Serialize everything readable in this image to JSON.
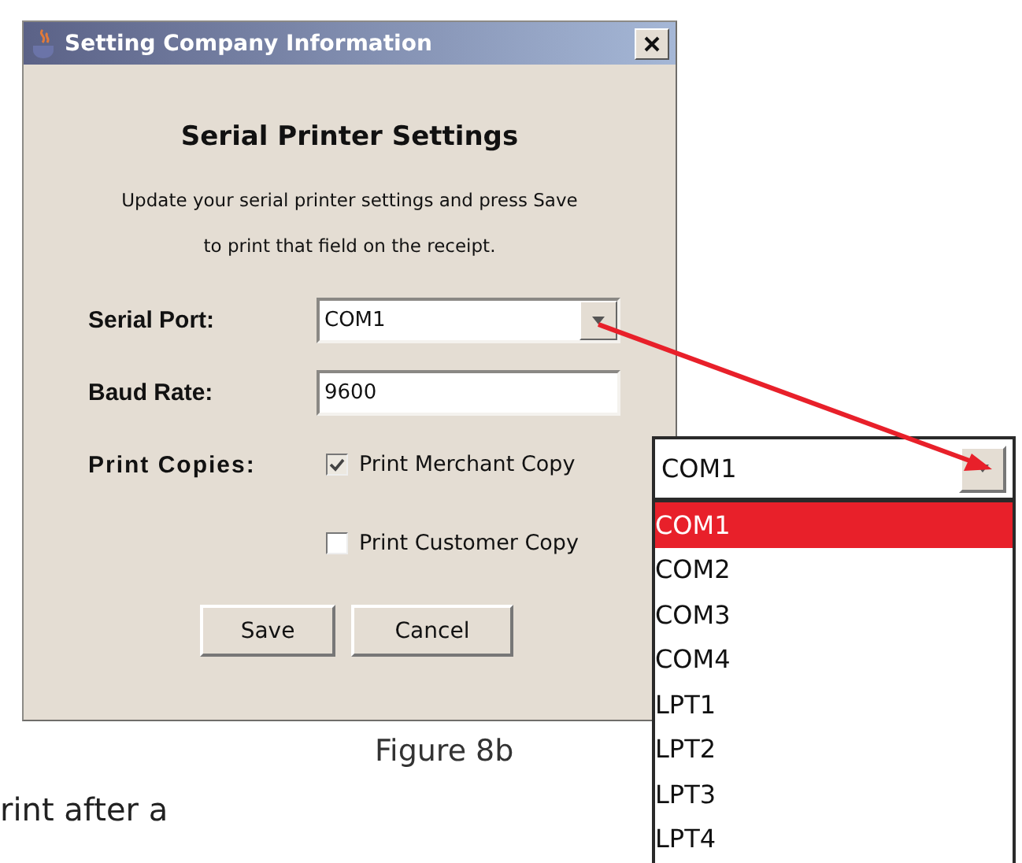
{
  "window": {
    "title": "Setting Company Information"
  },
  "heading": "Serial Printer Settings",
  "description": [
    "Update your serial printer settings and press Save",
    "to print that field on the receipt."
  ],
  "serial_port": {
    "label": "Serial Port:",
    "value": "COM1"
  },
  "baud_rate": {
    "label": "Baud Rate:",
    "value": "9600"
  },
  "print_copies": {
    "label": "Print Copies:",
    "options": [
      {
        "label": "Print Merchant Copy",
        "checked": true
      },
      {
        "label": "Print Customer Copy",
        "checked": false
      }
    ]
  },
  "buttons": [
    "Save",
    "Cancel"
  ],
  "dropdown_inset": {
    "value": "COM1",
    "options": [
      {
        "label": "COM1",
        "selected": true
      },
      {
        "label": "COM2",
        "selected": false
      },
      {
        "label": "COM3",
        "selected": false
      },
      {
        "label": "COM4",
        "selected": false
      },
      {
        "label": "LPT1",
        "selected": false
      },
      {
        "label": "LPT2",
        "selected": false
      },
      {
        "label": "LPT3",
        "selected": false
      },
      {
        "label": "LPT4",
        "selected": false
      }
    ]
  },
  "caption": "Figure 8b",
  "body_text": "rint after a"
}
